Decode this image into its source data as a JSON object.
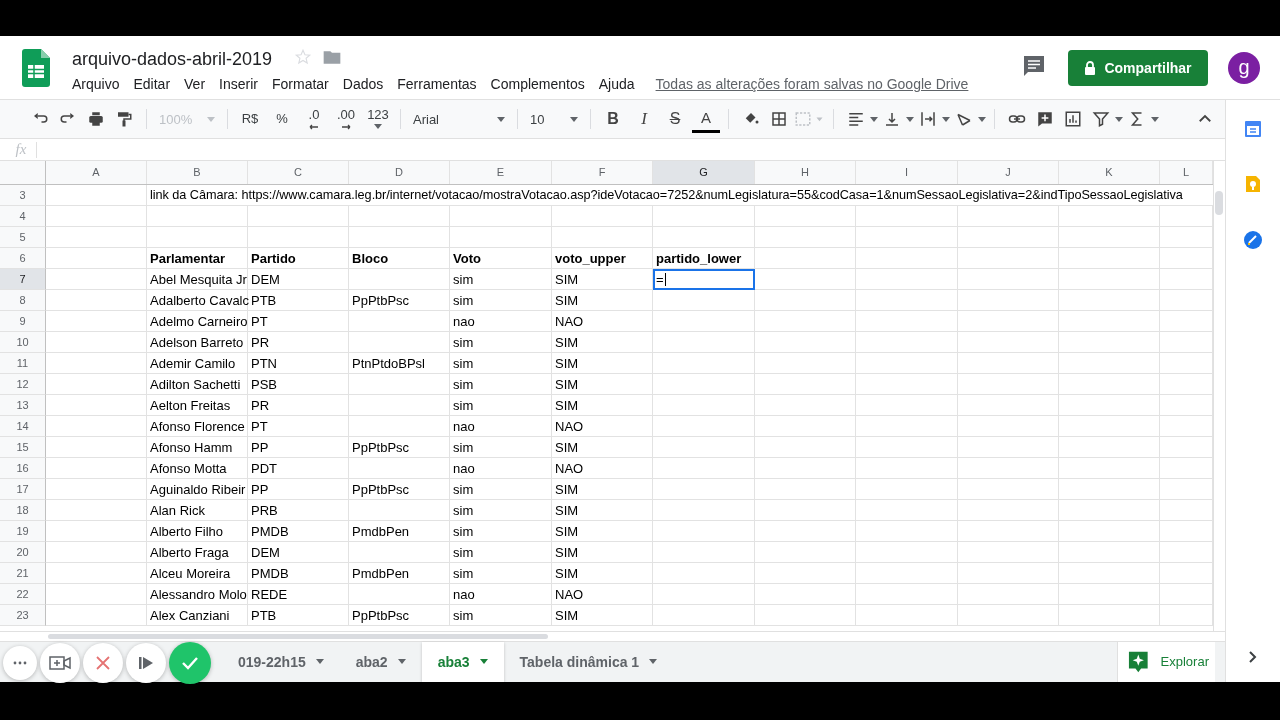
{
  "document": {
    "title": "arquivo-dados-abril-2019"
  },
  "menu": [
    "Arquivo",
    "Editar",
    "Ver",
    "Inserir",
    "Formatar",
    "Dados",
    "Ferramentas",
    "Complementos",
    "Ajuda"
  ],
  "save_status": "Todas as alterações foram salvas no Google Drive",
  "share_button": "Compartilhar",
  "avatar": "g",
  "toolbar": {
    "zoom": {
      "value": "100%",
      "disabled": true
    },
    "number_formats": [
      "R$",
      "%",
      ".0",
      ".00",
      "123"
    ],
    "font": "Arial",
    "font_size": "10",
    "text_styles": [
      "B",
      "I",
      "S",
      "A"
    ]
  },
  "formula_bar": {
    "label": "fx"
  },
  "columns": [
    {
      "label": "A",
      "selected": false
    },
    {
      "label": "B",
      "selected": false
    },
    {
      "label": "C",
      "selected": false
    },
    {
      "label": "D",
      "selected": false
    },
    {
      "label": "E",
      "selected": false
    },
    {
      "label": "F",
      "selected": false
    },
    {
      "label": "G",
      "selected": true
    },
    {
      "label": "H",
      "selected": false
    },
    {
      "label": "I",
      "selected": false
    },
    {
      "label": "J",
      "selected": false
    },
    {
      "label": "K",
      "selected": false
    },
    {
      "label": "L",
      "selected": false
    }
  ],
  "rows": [
    {
      "number": "3",
      "selected": false,
      "kind": "note",
      "text": "link da Câmara: https://www.camara.leg.br/internet/votacao/mostraVotacao.asp?ideVotacao=7252&numLegislatura=55&codCasa=1&numSessaoLegislativa=2&indTipoSessaoLegislativa"
    },
    {
      "number": "4",
      "selected": false,
      "kind": "blank"
    },
    {
      "number": "5",
      "selected": false,
      "kind": "blank"
    },
    {
      "number": "6",
      "selected": false,
      "kind": "header",
      "parlamentar": "Parlamentar",
      "partido": "Partido",
      "bloco": "Bloco",
      "voto": "Voto",
      "voto_upper": "voto_upper",
      "partido_lower": "partido_lower"
    },
    {
      "number": "7",
      "selected": true,
      "kind": "data",
      "parlamentar": "Abel Mesquita Jr",
      "partido": "DEM",
      "voto": "sim",
      "voto_upper": "SIM",
      "partido_lower": "="
    },
    {
      "number": "8",
      "selected": false,
      "kind": "data",
      "parlamentar": "Adalberto Cavalc",
      "partido": "PTB",
      "bloco": "PpPtbPsc",
      "voto": "sim",
      "voto_upper": "SIM"
    },
    {
      "number": "9",
      "selected": false,
      "kind": "data",
      "parlamentar": "Adelmo Carneiro",
      "partido": "PT",
      "voto": "nao",
      "voto_upper": "NAO"
    },
    {
      "number": "10",
      "selected": false,
      "kind": "data",
      "parlamentar": "Adelson Barreto",
      "partido": "PR",
      "voto": "sim",
      "voto_upper": "SIM"
    },
    {
      "number": "11",
      "selected": false,
      "kind": "data",
      "parlamentar": "Ademir Camilo",
      "partido": "PTN",
      "bloco": "PtnPtdoBPsl",
      "voto": "sim",
      "voto_upper": "SIM"
    },
    {
      "number": "12",
      "selected": false,
      "kind": "data",
      "parlamentar": "Adilton Sachetti",
      "partido": "PSB",
      "voto": "sim",
      "voto_upper": "SIM"
    },
    {
      "number": "13",
      "selected": false,
      "kind": "data",
      "parlamentar": "Aelton Freitas",
      "partido": "PR",
      "voto": "sim",
      "voto_upper": "SIM"
    },
    {
      "number": "14",
      "selected": false,
      "kind": "data",
      "parlamentar": "Afonso Florence",
      "partido": "PT",
      "voto": "nao",
      "voto_upper": "NAO"
    },
    {
      "number": "15",
      "selected": false,
      "kind": "data",
      "parlamentar": "Afonso Hamm",
      "partido": "PP",
      "bloco": "PpPtbPsc",
      "voto": "sim",
      "voto_upper": "SIM"
    },
    {
      "number": "16",
      "selected": false,
      "kind": "data",
      "parlamentar": "Afonso Motta",
      "partido": "PDT",
      "voto": "nao",
      "voto_upper": "NAO"
    },
    {
      "number": "17",
      "selected": false,
      "kind": "data",
      "parlamentar": "Aguinaldo Ribeir",
      "partido": "PP",
      "bloco": "PpPtbPsc",
      "voto": "sim",
      "voto_upper": "SIM"
    },
    {
      "number": "18",
      "selected": false,
      "kind": "data",
      "parlamentar": "Alan Rick",
      "partido": "PRB",
      "voto": "sim",
      "voto_upper": "SIM"
    },
    {
      "number": "19",
      "selected": false,
      "kind": "data",
      "parlamentar": "Alberto Filho",
      "partido": "PMDB",
      "bloco": "PmdbPen",
      "voto": "sim",
      "voto_upper": "SIM"
    },
    {
      "number": "20",
      "selected": false,
      "kind": "data",
      "parlamentar": "Alberto Fraga",
      "partido": "DEM",
      "voto": "sim",
      "voto_upper": "SIM"
    },
    {
      "number": "21",
      "selected": false,
      "kind": "data",
      "parlamentar": "Alceu Moreira",
      "partido": "PMDB",
      "bloco": "PmdbPen",
      "voto": "sim",
      "voto_upper": "SIM"
    },
    {
      "number": "22",
      "selected": false,
      "kind": "data",
      "parlamentar": "Alessandro Molo",
      "partido": "REDE",
      "voto": "nao",
      "voto_upper": "NAO"
    },
    {
      "number": "23",
      "selected": false,
      "kind": "data",
      "parlamentar": "Alex Canziani",
      "partido": "PTB",
      "bloco": "PpPtbPsc",
      "voto": "sim",
      "voto_upper": "SIM"
    }
  ],
  "sheet_tabs": [
    {
      "label": "019-22h15",
      "selected": false
    },
    {
      "label": "aba2",
      "selected": false
    },
    {
      "label": "aba3",
      "selected": true
    },
    {
      "label": "Tabela dinâmica 1",
      "selected": false
    }
  ],
  "explore_button": "Explorar"
}
